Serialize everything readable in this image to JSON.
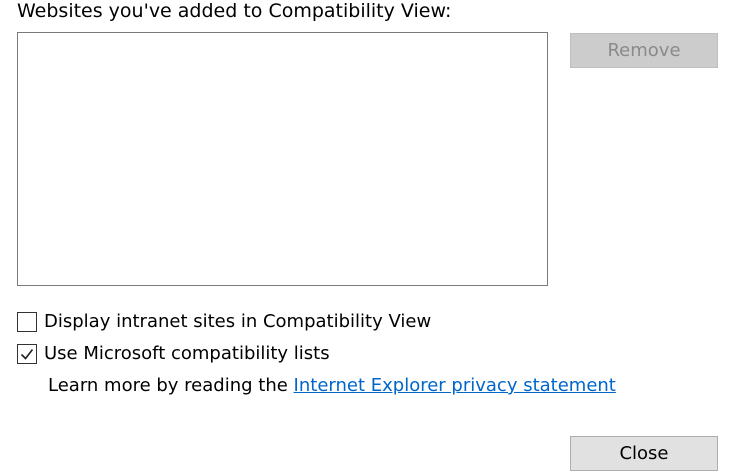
{
  "dialog": {
    "websites_label": "Websites you've added to Compatibility View:",
    "websites": [],
    "remove_label": "Remove",
    "remove_enabled": false,
    "intranet_label": "Display intranet sites in Compatibility View",
    "intranet_checked": false,
    "mslists_label": "Use Microsoft compatibility lists",
    "mslists_checked": true,
    "learn_more_prefix": "Learn more by reading the",
    "privacy_link": "Internet Explorer privacy statement",
    "close_label": "Close"
  },
  "colors": {
    "link": "#0066cc",
    "button_bg": "#e1e1e1",
    "disabled_text": "#8a8a8a"
  },
  "icons": {
    "checkmark": "check-icon"
  }
}
